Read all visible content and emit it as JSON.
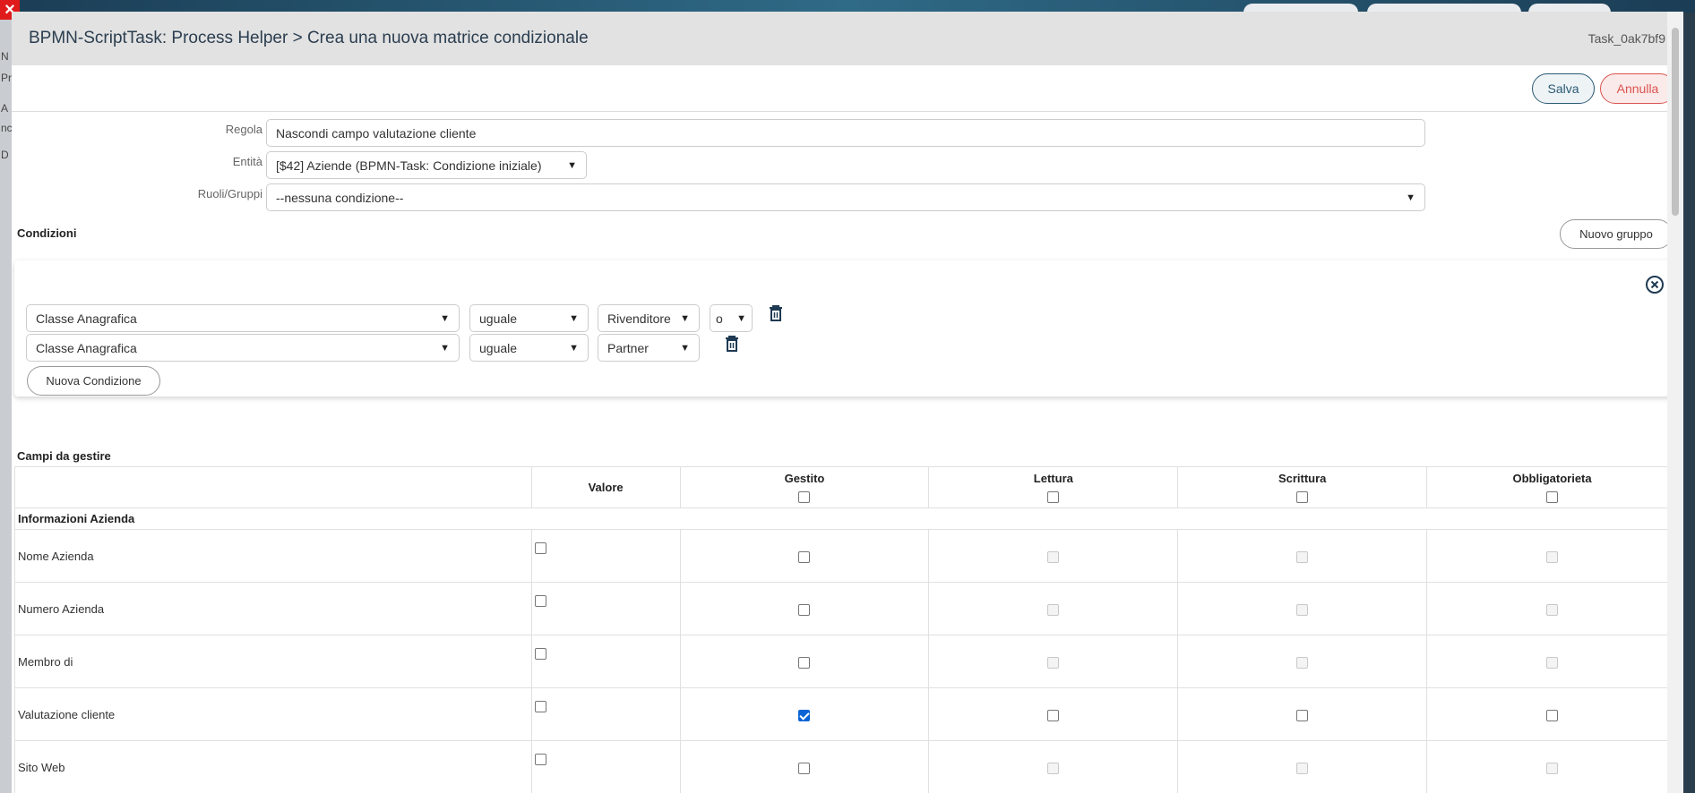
{
  "background": {
    "left_fragments": [
      "N",
      "Pr",
      "A",
      "nc",
      "D"
    ]
  },
  "modal": {
    "title": "BPMN-ScriptTask: Process Helper > Crea una nuova matrice condizionale",
    "task_id": "Task_0ak7bf9",
    "save_label": "Salva",
    "cancel_label": "Annulla"
  },
  "form": {
    "rule_label": "Regola",
    "rule_value": "Nascondi campo valutazione cliente",
    "entity_label": "Entità",
    "entity_value": "[$42] Aziende (BPMN-Task: Condizione iniziale)",
    "roles_label": "Ruoli/Gruppi",
    "roles_value": "--nessuna condizione--"
  },
  "conditions": {
    "title": "Condizioni",
    "new_group_label": "Nuovo gruppo",
    "new_condition_label": "Nuova Condizione",
    "rows": [
      {
        "field": "Classe Anagrafica",
        "operator": "uguale",
        "value": "Rivenditore",
        "join": "o"
      },
      {
        "field": "Classe Anagrafica",
        "operator": "uguale",
        "value": "Partner"
      }
    ]
  },
  "fields": {
    "title": "Campi da gestire",
    "headers": {
      "value": "Valore",
      "managed": "Gestito",
      "read": "Lettura",
      "write": "Scrittura",
      "required": "Obbligatorieta"
    },
    "group": "Informazioni Azienda",
    "rows": [
      {
        "name": "Nome Azienda",
        "managed": false,
        "enabled": false
      },
      {
        "name": "Numero Azienda",
        "managed": false,
        "enabled": false
      },
      {
        "name": "Membro di",
        "managed": false,
        "enabled": false
      },
      {
        "name": "Valutazione cliente",
        "managed": true,
        "enabled": true
      },
      {
        "name": "Sito Web",
        "managed": false,
        "enabled": false
      }
    ]
  }
}
